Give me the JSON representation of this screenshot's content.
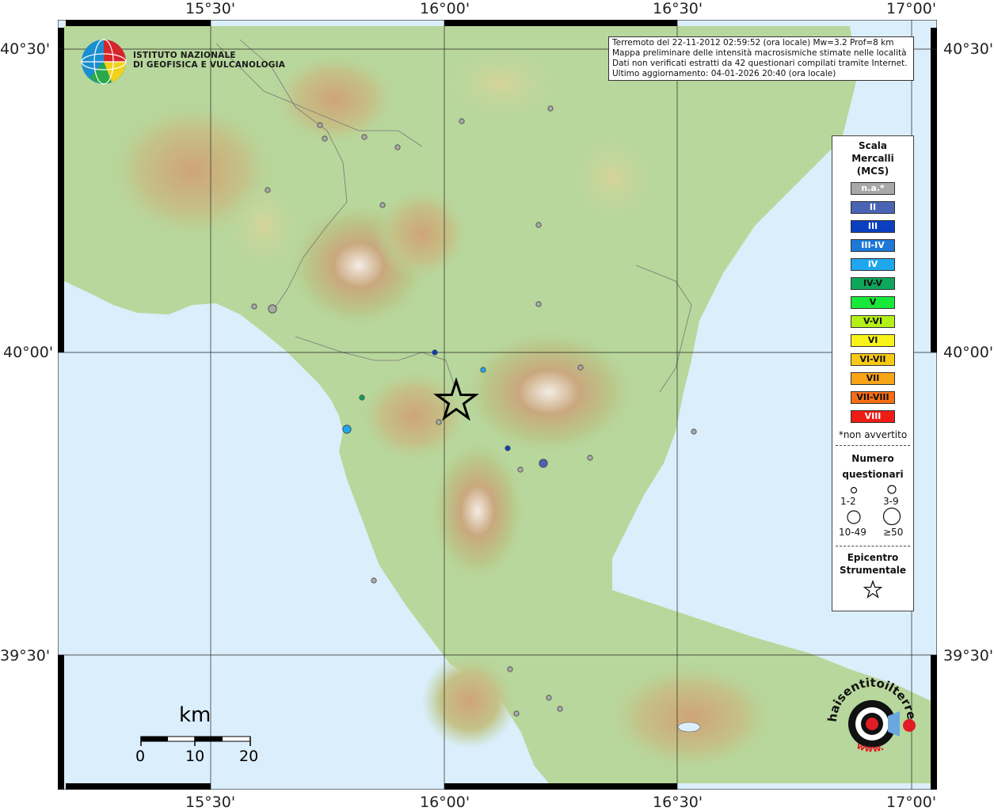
{
  "map": {
    "lon_labels": [
      "15°30'",
      "16°00'",
      "16°30'",
      "17°00'"
    ],
    "lat_labels": [
      "40°30'",
      "40°00'",
      "39°30'"
    ],
    "institute_line1": "ISTITUTO NAZIONALE",
    "institute_line2": "DI GEOFISICA E VULCANOLOGIA"
  },
  "info": {
    "line1": "Terremoto del 22-11-2012 02:59:52 (ora locale) Mw=3.2 Prof=8 km",
    "line2": "Mappa preliminare delle intensità macrosismiche stimate nelle località",
    "line3": "Dati non verificati estratti da 42 questionari compilati tramite Internet.",
    "line4": "Ultimo aggiornamento: 04-01-2026 20:40 (ora locale)"
  },
  "legend": {
    "title_line1": "Scala",
    "title_line2": "Mercalli",
    "title_line3": "(MCS)",
    "levels": [
      {
        "label": "n.a.*",
        "color": "#a8a8a8",
        "text_color": "#ffffff"
      },
      {
        "label": "II",
        "color": "#4a63b4",
        "text_color": "#ffffff"
      },
      {
        "label": "III",
        "color": "#0a3fc0",
        "text_color": "#ffffff"
      },
      {
        "label": "III-IV",
        "color": "#1e78d8",
        "text_color": "#ffffff"
      },
      {
        "label": "IV",
        "color": "#1ea6ee",
        "text_color": "#ffffff"
      },
      {
        "label": "IV-V",
        "color": "#0ea65a",
        "text_color": "#111111"
      },
      {
        "label": "V",
        "color": "#18e83a",
        "text_color": "#111111"
      },
      {
        "label": "V-VI",
        "color": "#b4f018",
        "text_color": "#111111"
      },
      {
        "label": "VI",
        "color": "#f8f41a",
        "text_color": "#111111"
      },
      {
        "label": "VI-VII",
        "color": "#f8c816",
        "text_color": "#111111"
      },
      {
        "label": "VII",
        "color": "#f8a418",
        "text_color": "#111111"
      },
      {
        "label": "VII-VIII",
        "color": "#f86e14",
        "text_color": "#111111"
      },
      {
        "label": "VIII",
        "color": "#ee1c14",
        "text_color": "#ffffff"
      }
    ],
    "not_felt_note": "*non avvertito",
    "count_title_line1": "Numero",
    "count_title_line2": "questionari",
    "count_classes": [
      "1-2",
      "3-9",
      "10-49",
      "≥50"
    ],
    "epicenter_line1": "Epicentro",
    "epicenter_line2": "Strumentale"
  },
  "scalebar": {
    "unit": "km",
    "ticks": [
      "0",
      "10",
      "20"
    ]
  },
  "badge": {
    "site_text": "haisentitoilterremoto.it",
    "www_text": "www."
  },
  "colors": {
    "sea": "#dbeefb",
    "epicenter": "#000000",
    "not_available": "#a8a8a8"
  },
  "observations": [
    {
      "intensity": "n.a.",
      "questionnaires": "1-2"
    },
    {
      "intensity": "n.a.",
      "questionnaires": "1-2"
    },
    {
      "intensity": "n.a.",
      "questionnaires": "1-2"
    },
    {
      "intensity": "n.a.",
      "questionnaires": "1-2"
    },
    {
      "intensity": "n.a.",
      "questionnaires": "1-2"
    },
    {
      "intensity": "n.a.",
      "questionnaires": "1-2"
    },
    {
      "intensity": "n.a.",
      "questionnaires": "1-2"
    },
    {
      "intensity": "n.a.",
      "questionnaires": "1-2"
    },
    {
      "intensity": "n.a.",
      "questionnaires": "1-2"
    },
    {
      "intensity": "n.a.",
      "questionnaires": "1-2"
    },
    {
      "intensity": "n.a.",
      "questionnaires": "1-2"
    },
    {
      "intensity": "n.a.",
      "questionnaires": "3-9"
    },
    {
      "intensity": "III",
      "questionnaires": "1-2"
    },
    {
      "intensity": "IV",
      "questionnaires": "1-2"
    },
    {
      "intensity": "IV-V",
      "questionnaires": "1-2"
    },
    {
      "intensity": "IV",
      "questionnaires": "3-9"
    },
    {
      "intensity": "n.a.",
      "questionnaires": "1-2"
    },
    {
      "intensity": "III",
      "questionnaires": "1-2"
    },
    {
      "intensity": "n.a.",
      "questionnaires": "1-2"
    },
    {
      "intensity": "II",
      "questionnaires": "3-9"
    },
    {
      "intensity": "n.a.",
      "questionnaires": "1-2"
    },
    {
      "intensity": "n.a.",
      "questionnaires": "1-2"
    },
    {
      "intensity": "n.a.",
      "questionnaires": "1-2"
    },
    {
      "intensity": "n.a.",
      "questionnaires": "1-2"
    },
    {
      "intensity": "n.a.",
      "questionnaires": "1-2"
    },
    {
      "intensity": "n.a.",
      "questionnaires": "1-2"
    },
    {
      "intensity": "n.a.",
      "questionnaires": "1-2"
    },
    {
      "intensity": "n.a.",
      "questionnaires": "1-2"
    }
  ]
}
